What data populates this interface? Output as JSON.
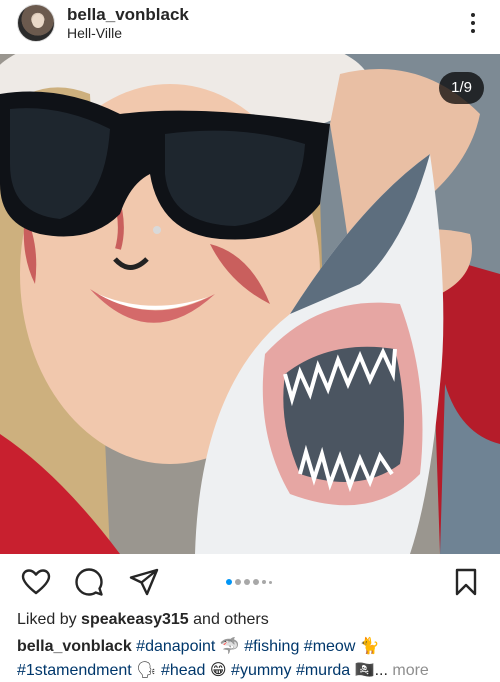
{
  "header": {
    "username": "bella_vonblack",
    "location": "Hell-Ville"
  },
  "post": {
    "counter": "1/9",
    "carousel_total": 9,
    "carousel_active": 1
  },
  "likes": {
    "prefix": "Liked by ",
    "user": "speakeasy315",
    "suffix": " and others"
  },
  "caption": {
    "author": "bella_vonblack",
    "line1_tags": [
      "#danapoint",
      "#fishing",
      "#meow"
    ],
    "line2_tags": [
      "#1stamendment",
      "#head",
      "#yummy",
      "#murda"
    ],
    "emojis": {
      "after_danapoint": "🦈",
      "after_meow": "🐈",
      "after_1stamendment": "🗣",
      "after_head": "😁",
      "after_murda": "🏴‍☠️"
    },
    "ellipsis": "...",
    "more_label": "more"
  },
  "icons": {
    "like": "heart-icon",
    "comment": "comment-icon",
    "share": "send-icon",
    "save": "bookmark-icon",
    "options": "more-options-icon"
  },
  "colors": {
    "link": "#00376b",
    "active_dot": "#0095f6",
    "muted": "#8e8e8e"
  }
}
